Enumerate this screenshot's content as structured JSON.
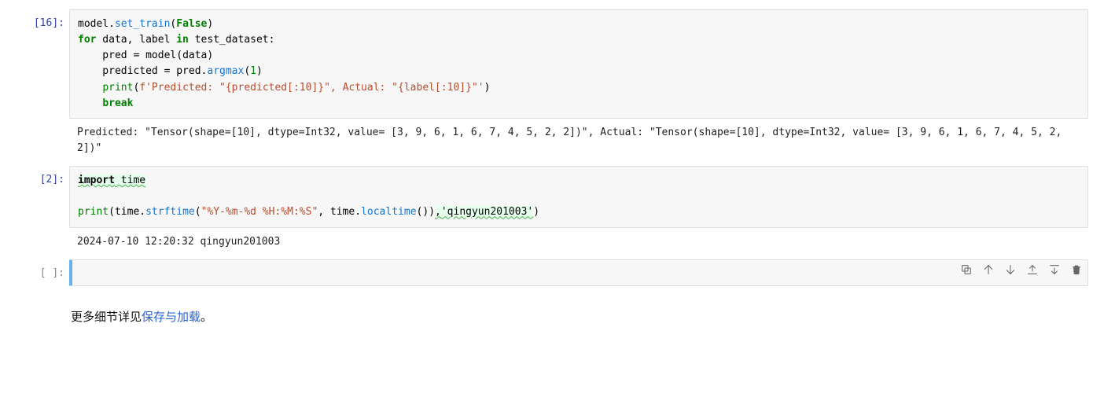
{
  "cells": {
    "c16": {
      "prompt": "[16]:",
      "code": {
        "l1_name": "model",
        "l1_dot": ".",
        "l1_fn": "set_train",
        "l1_open": "(",
        "l1_false": "False",
        "l1_close": ")",
        "l2_for": "for",
        "l2_vars": " data, label ",
        "l2_in": "in",
        "l2_rest": " test_dataset:",
        "l3": "    pred ",
        "l3_eq": "=",
        "l3b": " model(data)",
        "l4": "    predicted ",
        "l4_eq": "=",
        "l4b": " pred",
        "l4_dot": ".",
        "l4_fn": "argmax",
        "l4_open": "(",
        "l4_num": "1",
        "l4_close": ")",
        "l5_indent": "    ",
        "l5_print": "print",
        "l5_open": "(",
        "l5_f": "f",
        "l5_s1": "'Predicted: \"",
        "l5_i1": "{predicted[:",
        "l5_n1": "10",
        "l5_i1b": "]}",
        "l5_s2": "\", Actual: \"",
        "l5_i2": "{label[:",
        "l5_n2": "10",
        "l5_i2b": "]}",
        "l5_s3": "\"'",
        "l5_close": ")",
        "l6_indent": "    ",
        "l6_break": "break"
      },
      "output": "Predicted: \"Tensor(shape=[10], dtype=Int32, value= [3, 9, 6, 1, 6, 7, 4, 5, 2, 2])\", Actual: \"Tensor(shape=[10], dtype=Int32, value= [3, 9, 6, 1, 6, 7, 4, 5, 2, 2])\""
    },
    "c2": {
      "prompt": "[2]:",
      "code": {
        "l1_import": "import",
        "l1_sp": " ",
        "l1_time": "time",
        "blank": "",
        "l3_print": "print",
        "l3_open": "(",
        "l3_time": "time",
        "l3_dot": ".",
        "l3_fn": "strftime",
        "l3_open2": "(",
        "l3_str": "\"%Y-%m-%d %H:%M:%S\"",
        "l3_comma": ", ",
        "l3_time2": "time",
        "l3_dot2": ".",
        "l3_fn2": "localtime",
        "l3_call": "()",
        "l3_close2": ")",
        "l3_comma2": ",",
        "l3_ins": "'qingyun201003'",
        "l3_close": ")"
      },
      "output": "2024-07-10 12:20:32 qingyun201003"
    },
    "cEmpty": {
      "prompt": "[ ]:"
    }
  },
  "markdown": {
    "prefix": "更多细节详见",
    "link_text": "保存与加载",
    "suffix": "。"
  },
  "toolbar": {
    "copy": "copy",
    "up": "move-up",
    "down": "move-down",
    "insert_above": "insert-above",
    "insert_below": "insert-below",
    "delete": "delete"
  }
}
